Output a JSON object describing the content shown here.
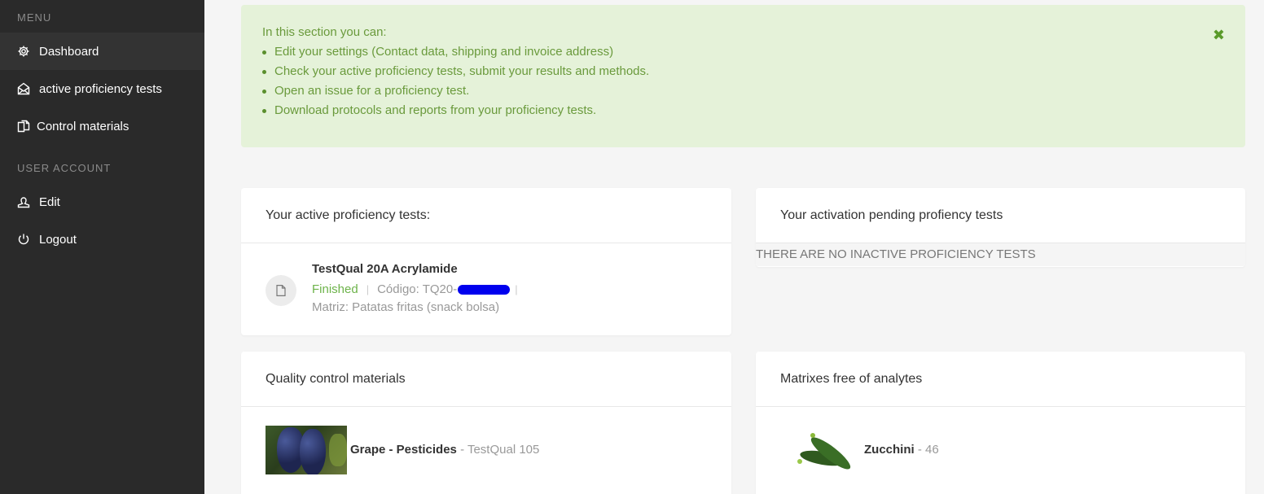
{
  "sidebar": {
    "menu_heading": "MENU",
    "items": [
      {
        "label": "Dashboard",
        "icon": "gear-icon",
        "active": true
      },
      {
        "label": "active proficiency tests",
        "icon": "envelope-open-icon",
        "active": false
      },
      {
        "label": "Control materials",
        "icon": "documents-icon",
        "active": false
      }
    ],
    "account_heading": "USER ACCOUNT",
    "account_items": [
      {
        "label": "Edit",
        "icon": "user-icon"
      },
      {
        "label": "Logout",
        "icon": "power-icon"
      }
    ]
  },
  "alert": {
    "intro": "In this section you can:",
    "items": [
      "Edit your settings (Contact data, shipping and invoice address)",
      "Check your active proficiency tests, submit your results and methods.",
      "Open an issue for a proficiency test.",
      "Download protocols and reports from your proficiency tests."
    ],
    "close_glyph": "✖"
  },
  "active_tests": {
    "title": "Your active proficiency tests:",
    "items": [
      {
        "name": "TestQual 20A Acrylamide",
        "status": "Finished",
        "code_label": "Código: TQ20-",
        "matrix": "Matriz: Patatas fritas (snack bolsa)"
      }
    ]
  },
  "pending_tests": {
    "title": "Your activation pending profiency tests",
    "empty_message": "THERE ARE NO INACTIVE PROFICIENCY TESTS"
  },
  "quality_materials": {
    "title": "Quality control materials",
    "items": [
      {
        "name": "Grape - Pesticides",
        "sub": " - TestQual 105",
        "image": "grape-image"
      }
    ]
  },
  "matrixes": {
    "title": "Matrixes free of analytes",
    "items": [
      {
        "name": "Zucchini",
        "sub": " - 46",
        "image": "zucchini-image"
      }
    ]
  },
  "colors": {
    "sidebar_bg": "#2a2a2a",
    "alert_bg": "#e5f2d9",
    "alert_text": "#6a9a3c",
    "status_finished": "#6db34a"
  }
}
